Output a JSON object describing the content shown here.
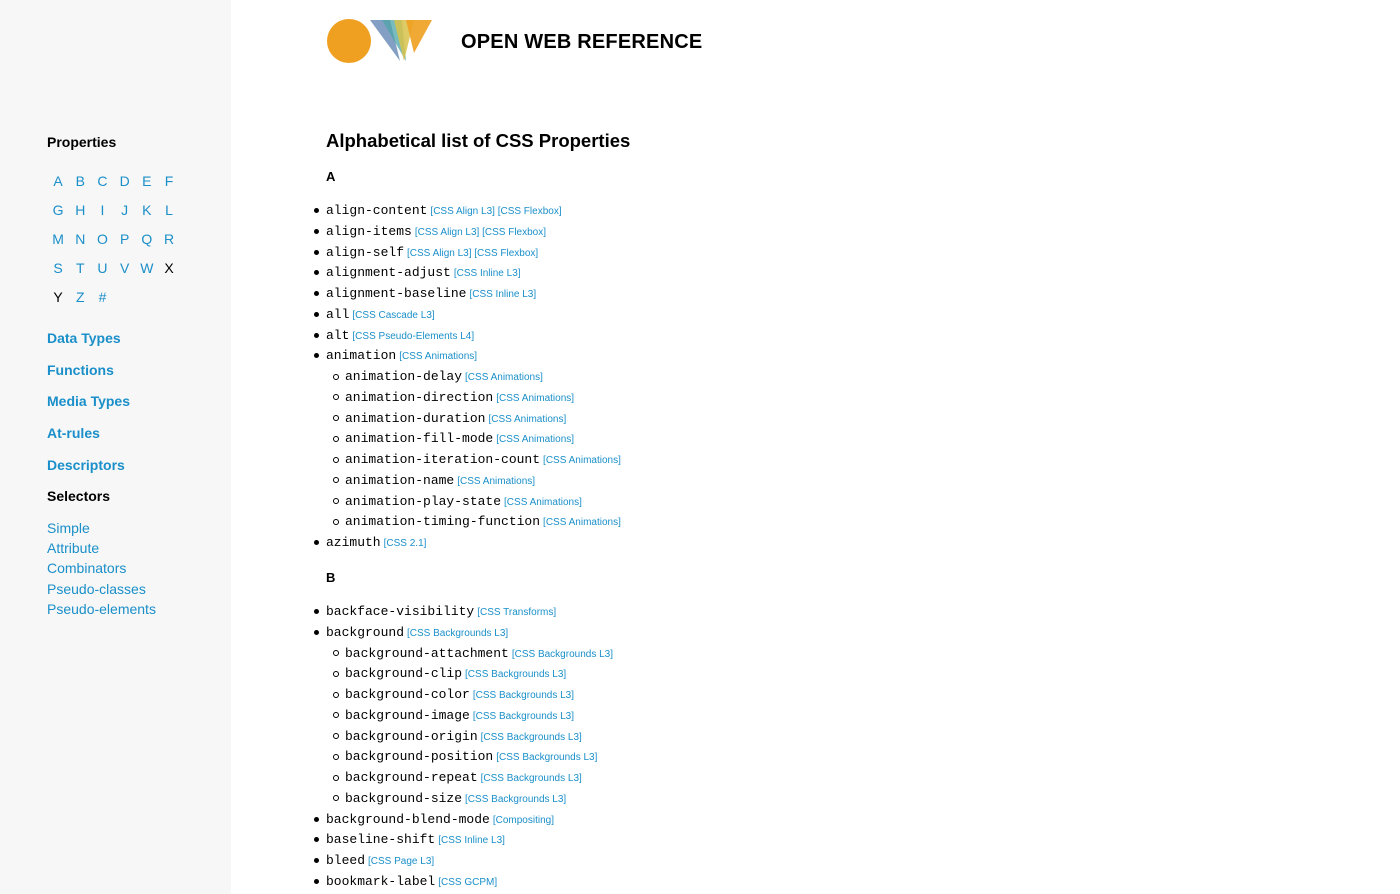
{
  "site": {
    "title": "OPEN WEB REFERENCE"
  },
  "colors": {
    "link": "#1a8fc9",
    "logo_circle": "#f0a020",
    "sidebar_bg": "#f7f7f7"
  },
  "sidebar": {
    "properties_heading": "Properties",
    "letters": [
      [
        "A",
        "B",
        "C",
        "D",
        "E",
        "F"
      ],
      [
        "G",
        "H",
        "I",
        "J",
        "K",
        "L"
      ],
      [
        "M",
        "N",
        "O",
        "P",
        "Q",
        "R"
      ],
      [
        "S",
        "T",
        "U",
        "V",
        "W",
        "X"
      ],
      [
        "Y",
        "Z",
        "#"
      ]
    ],
    "inactive_letters": [
      "X",
      "Y"
    ],
    "nav": [
      {
        "label": "Data Types"
      },
      {
        "label": "Functions"
      },
      {
        "label": "Media Types"
      },
      {
        "label": "At-rules"
      },
      {
        "label": "Descriptors"
      }
    ],
    "selectors_heading": "Selectors",
    "selectors": [
      "Simple",
      "Attribute",
      "Combinators",
      "Pseudo-classes",
      "Pseudo-elements"
    ]
  },
  "main": {
    "title": "Alphabetical list of CSS Properties",
    "sections": [
      {
        "letter": "A",
        "items": [
          {
            "name": "align-content",
            "level": 1,
            "specs": [
              "[CSS Align L3]",
              "[CSS Flexbox]"
            ]
          },
          {
            "name": "align-items",
            "level": 1,
            "specs": [
              "[CSS Align L3]",
              "[CSS Flexbox]"
            ]
          },
          {
            "name": "align-self",
            "level": 1,
            "specs": [
              "[CSS Align L3]",
              "[CSS Flexbox]"
            ]
          },
          {
            "name": "alignment-adjust",
            "level": 1,
            "specs": [
              "[CSS Inline L3]"
            ]
          },
          {
            "name": "alignment-baseline",
            "level": 1,
            "specs": [
              "[CSS Inline L3]"
            ]
          },
          {
            "name": "all",
            "level": 1,
            "specs": [
              "[CSS Cascade L3]"
            ]
          },
          {
            "name": "alt",
            "level": 1,
            "specs": [
              "[CSS Pseudo-Elements L4]"
            ]
          },
          {
            "name": "animation",
            "level": 1,
            "specs": [
              "[CSS Animations]"
            ]
          },
          {
            "name": "animation-delay",
            "level": 2,
            "specs": [
              "[CSS Animations]"
            ]
          },
          {
            "name": "animation-direction",
            "level": 2,
            "specs": [
              "[CSS Animations]"
            ]
          },
          {
            "name": "animation-duration",
            "level": 2,
            "specs": [
              "[CSS Animations]"
            ]
          },
          {
            "name": "animation-fill-mode",
            "level": 2,
            "specs": [
              "[CSS Animations]"
            ]
          },
          {
            "name": "animation-iteration-count",
            "level": 2,
            "specs": [
              "[CSS Animations]"
            ]
          },
          {
            "name": "animation-name",
            "level": 2,
            "specs": [
              "[CSS Animations]"
            ]
          },
          {
            "name": "animation-play-state",
            "level": 2,
            "specs": [
              "[CSS Animations]"
            ]
          },
          {
            "name": "animation-timing-function",
            "level": 2,
            "specs": [
              "[CSS Animations]"
            ]
          },
          {
            "name": "azimuth",
            "level": 1,
            "specs": [
              "[CSS 2.1]"
            ]
          }
        ]
      },
      {
        "letter": "B",
        "items": [
          {
            "name": "backface-visibility",
            "level": 1,
            "specs": [
              "[CSS Transforms]"
            ]
          },
          {
            "name": "background",
            "level": 1,
            "specs": [
              "[CSS Backgrounds L3]"
            ]
          },
          {
            "name": "background-attachment",
            "level": 2,
            "specs": [
              "[CSS Backgrounds L3]"
            ]
          },
          {
            "name": "background-clip",
            "level": 2,
            "specs": [
              "[CSS Backgrounds L3]"
            ]
          },
          {
            "name": "background-color",
            "level": 2,
            "specs": [
              "[CSS Backgrounds L3]"
            ]
          },
          {
            "name": "background-image",
            "level": 2,
            "specs": [
              "[CSS Backgrounds L3]"
            ]
          },
          {
            "name": "background-origin",
            "level": 2,
            "specs": [
              "[CSS Backgrounds L3]"
            ]
          },
          {
            "name": "background-position",
            "level": 2,
            "specs": [
              "[CSS Backgrounds L3]"
            ]
          },
          {
            "name": "background-repeat",
            "level": 2,
            "specs": [
              "[CSS Backgrounds L3]"
            ]
          },
          {
            "name": "background-size",
            "level": 2,
            "specs": [
              "[CSS Backgrounds L3]"
            ]
          },
          {
            "name": "background-blend-mode",
            "level": 1,
            "specs": [
              "[Compositing]"
            ]
          },
          {
            "name": "baseline-shift",
            "level": 1,
            "specs": [
              "[CSS Inline L3]"
            ]
          },
          {
            "name": "bleed",
            "level": 1,
            "specs": [
              "[CSS Page L3]"
            ]
          },
          {
            "name": "bookmark-label",
            "level": 1,
            "specs": [
              "[CSS GCPM]"
            ]
          }
        ]
      }
    ]
  }
}
